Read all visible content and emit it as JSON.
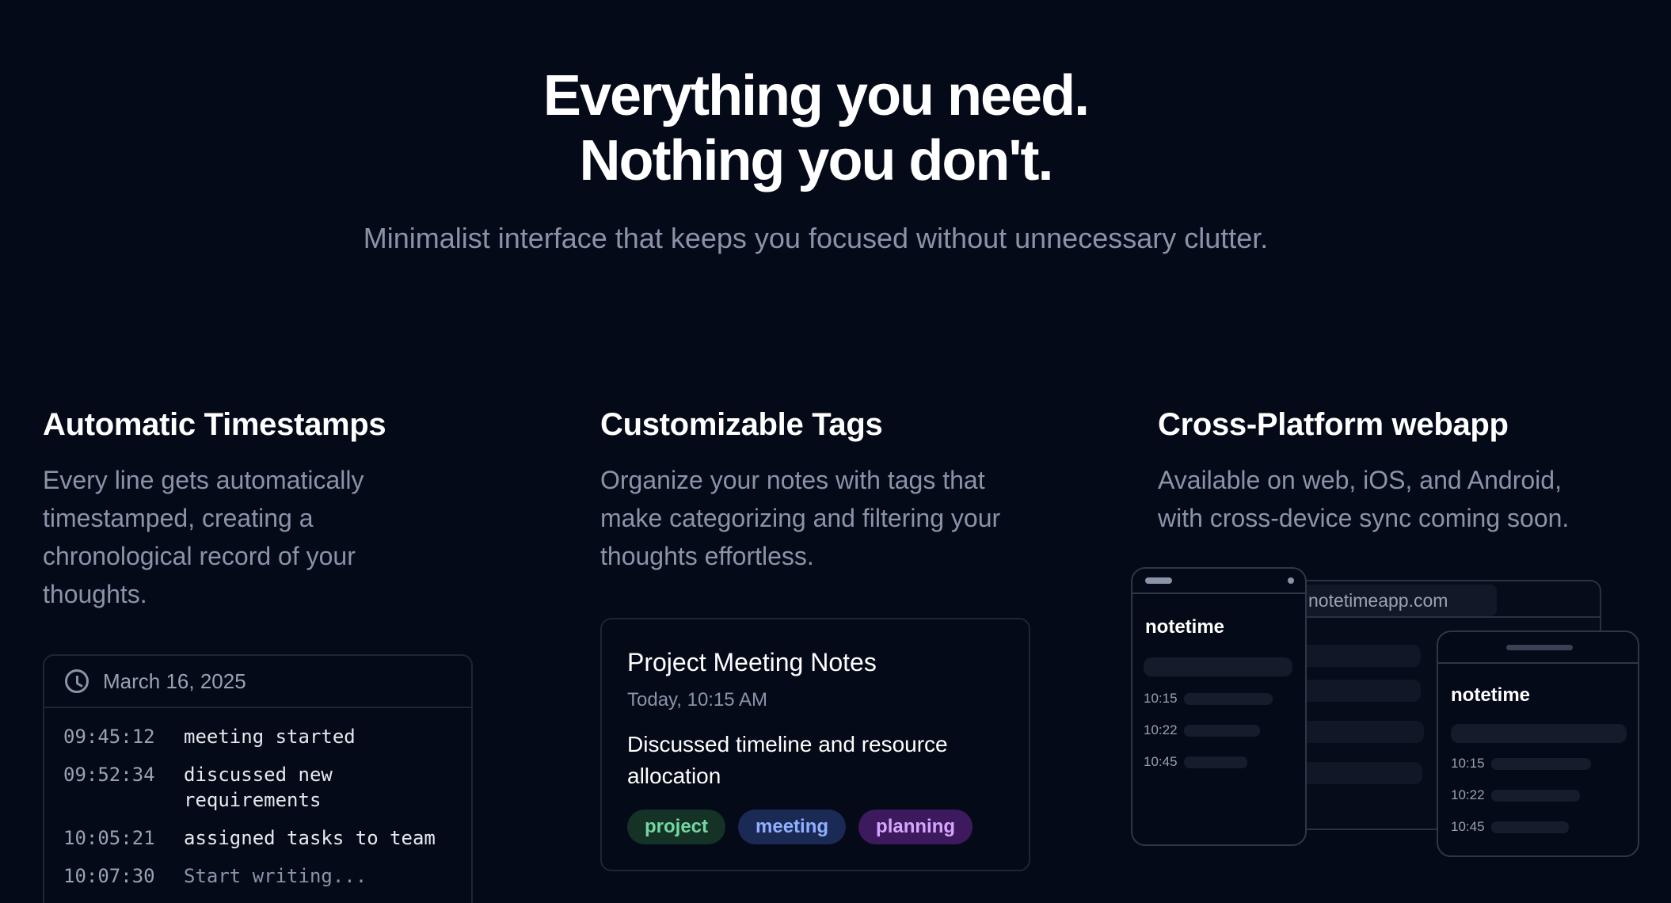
{
  "hero": {
    "title_line1": "Everything you need.",
    "title_line2": "Nothing you don't.",
    "subtitle": "Minimalist interface that keeps you focused without unnecessary clutter."
  },
  "features": [
    {
      "title": "Automatic Timestamps",
      "description": "Every line gets automatically timestamped, creating a chronological record of your thoughts."
    },
    {
      "title": "Customizable Tags",
      "description": "Organize your notes with tags that make categorizing and filtering your thoughts effortless."
    },
    {
      "title": "Cross-Platform webapp",
      "description": "Available on web, iOS, and Android, with cross-device sync coming soon."
    }
  ],
  "timestamp_card": {
    "date": "March 16, 2025",
    "icon": "clock-icon",
    "rows": [
      {
        "time": "09:45:12",
        "text": "meeting started"
      },
      {
        "time": "09:52:34",
        "text": "discussed new requirements"
      },
      {
        "time": "10:05:21",
        "text": "assigned tasks to team"
      },
      {
        "time": "10:07:30",
        "text": "Start writing..."
      }
    ]
  },
  "note_card": {
    "title": "Project Meeting Notes",
    "time": "Today, 10:15 AM",
    "body": "Discussed timeline and resource allocation",
    "tags": [
      {
        "label": "project",
        "color": "#74d6a2"
      },
      {
        "label": "meeting",
        "color": "#8fb0ff"
      },
      {
        "label": "planning",
        "color": "#d6a6ff"
      }
    ]
  },
  "devices": {
    "browser_url": "notetimeapp.com",
    "app_name": "notetime",
    "phone_times": [
      "10:15",
      "10:22",
      "10:45"
    ]
  },
  "colors": {
    "background": "#050a18",
    "muted_text": "#8b93a8",
    "border": "#1e2536"
  }
}
